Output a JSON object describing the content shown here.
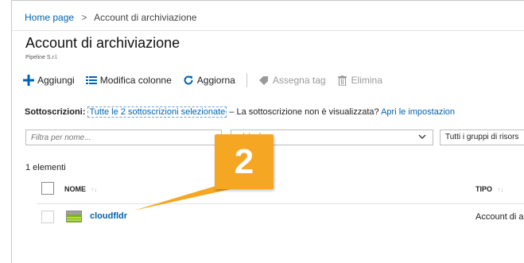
{
  "breadcrumb": {
    "home": "Home page",
    "separator": ">",
    "current": "Account di archiviazione"
  },
  "header": {
    "title": "Account di archiviazione",
    "subtitle": "Pipeline S.r.l."
  },
  "toolbar": {
    "add": "Aggiungi",
    "edit_columns": "Modifica colonne",
    "refresh": "Aggiorna",
    "assign_tag": "Assegna tag",
    "delete": "Elimina"
  },
  "subscriptions": {
    "label": "Sottoscrizioni:",
    "selected_link": "Tutte le 2 sottoscrizioni selezionate",
    "dash_text": " – La sottoscrizione non è visualizzata?",
    "settings_link": "Apri le impostazion"
  },
  "filters": {
    "name_placeholder": "Filtra per nome...",
    "subscription_dropdown": "crizioni",
    "resource_group_dropdown": "Tutti i gruppi di risors"
  },
  "list": {
    "count": "1 elementi",
    "columns": {
      "name": "NOME",
      "type": "TIPO"
    },
    "rows": [
      {
        "name": "cloudfldr",
        "type": "Account di ar"
      }
    ]
  },
  "callout": {
    "number": "2",
    "color": "#f5a623"
  },
  "colors": {
    "link": "#0063b1",
    "add_icon": "#0063b1",
    "callout": "#f5a623"
  }
}
